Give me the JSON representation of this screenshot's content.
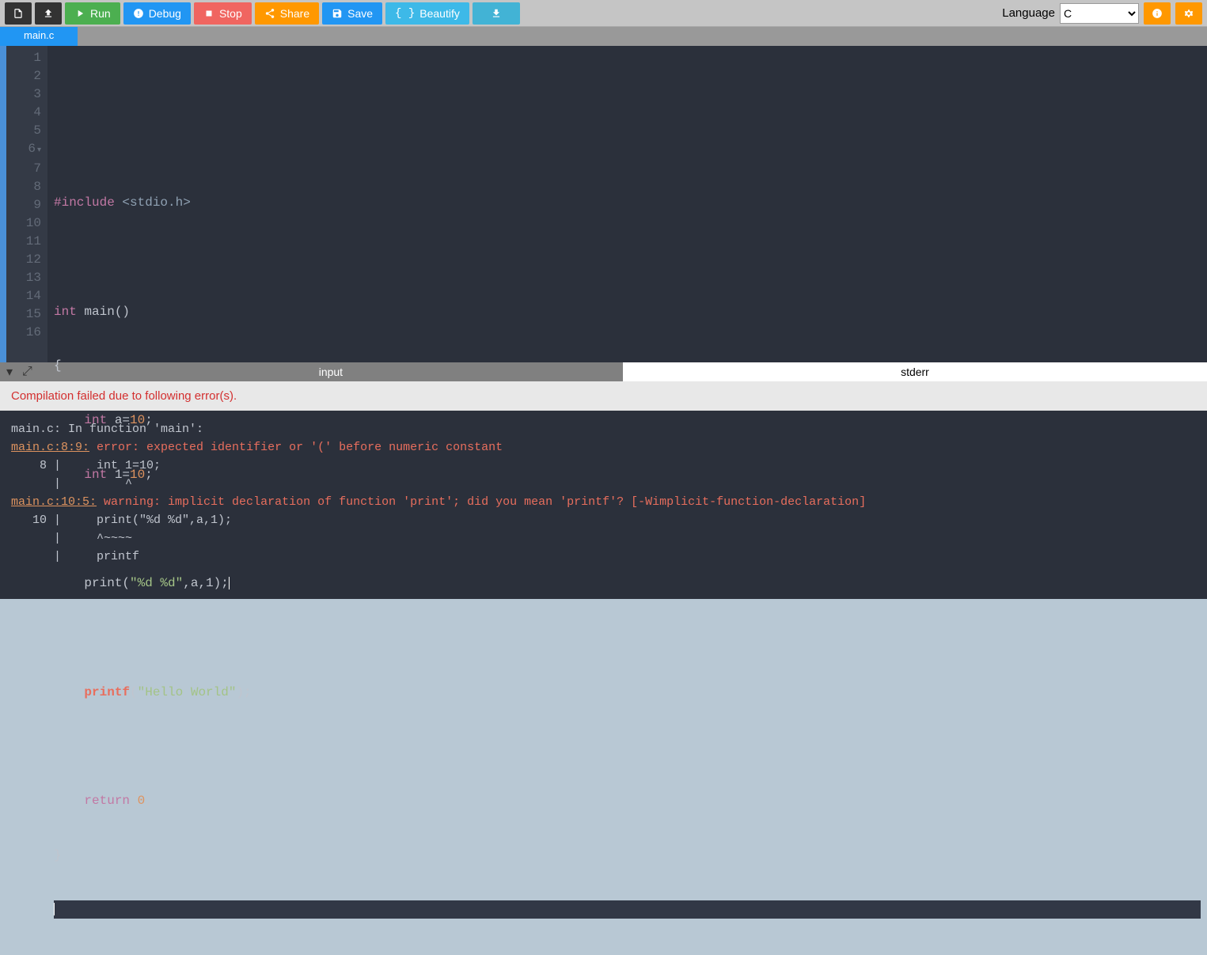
{
  "toolbar": {
    "run": "Run",
    "debug": "Debug",
    "stop": "Stop",
    "share": "Share",
    "save": "Save",
    "beautify": "Beautify"
  },
  "language": {
    "label": "Language",
    "selected": "C"
  },
  "tab": {
    "name": "main.c"
  },
  "editor": {
    "line_count": 16,
    "lines": {
      "l3_include": "#include",
      "l3_header": "<stdio.h>",
      "l5_int": "int",
      "l5_main": " main()",
      "l6": "{",
      "l7_int": "int",
      "l7_a": " a=",
      "l7_10": "10",
      "l7_semi": ";",
      "l8_int": "int",
      "l8_1": " 1=",
      "l8_10": "10",
      "l8_semi": ";",
      "l10_print": "print(",
      "l10_str": "\"%d %d\"",
      "l10_rest": ",a,1);",
      "l12_printf": "printf",
      "l12_paren": "(",
      "l12_str": "\"Hello World\"",
      "l12_close": ");",
      "l14_return": "return",
      "l14_zero": " 0",
      "l14_semi": ";",
      "l15": "}"
    }
  },
  "console_tabs": {
    "input": "input",
    "stderr": "stderr"
  },
  "error_header": "Compilation failed due to following error(s).",
  "console": {
    "l1": "main.c: In function 'main':",
    "l2_link": "main.c:8:9:",
    "l2_err": " error: expected identifier or '(' before numeric constant",
    "l3": "    8 |     int 1=10;",
    "l4": "      |         ^",
    "l5_link": "main.c:10:5:",
    "l5_warn": " warning: implicit declaration of function 'print'; did you mean 'printf'? [-Wimplicit-function-declaration]",
    "l6": "   10 |     print(\"%d %d\",a,1);",
    "l7": "      |     ^~~~~",
    "l8": "      |     printf"
  }
}
